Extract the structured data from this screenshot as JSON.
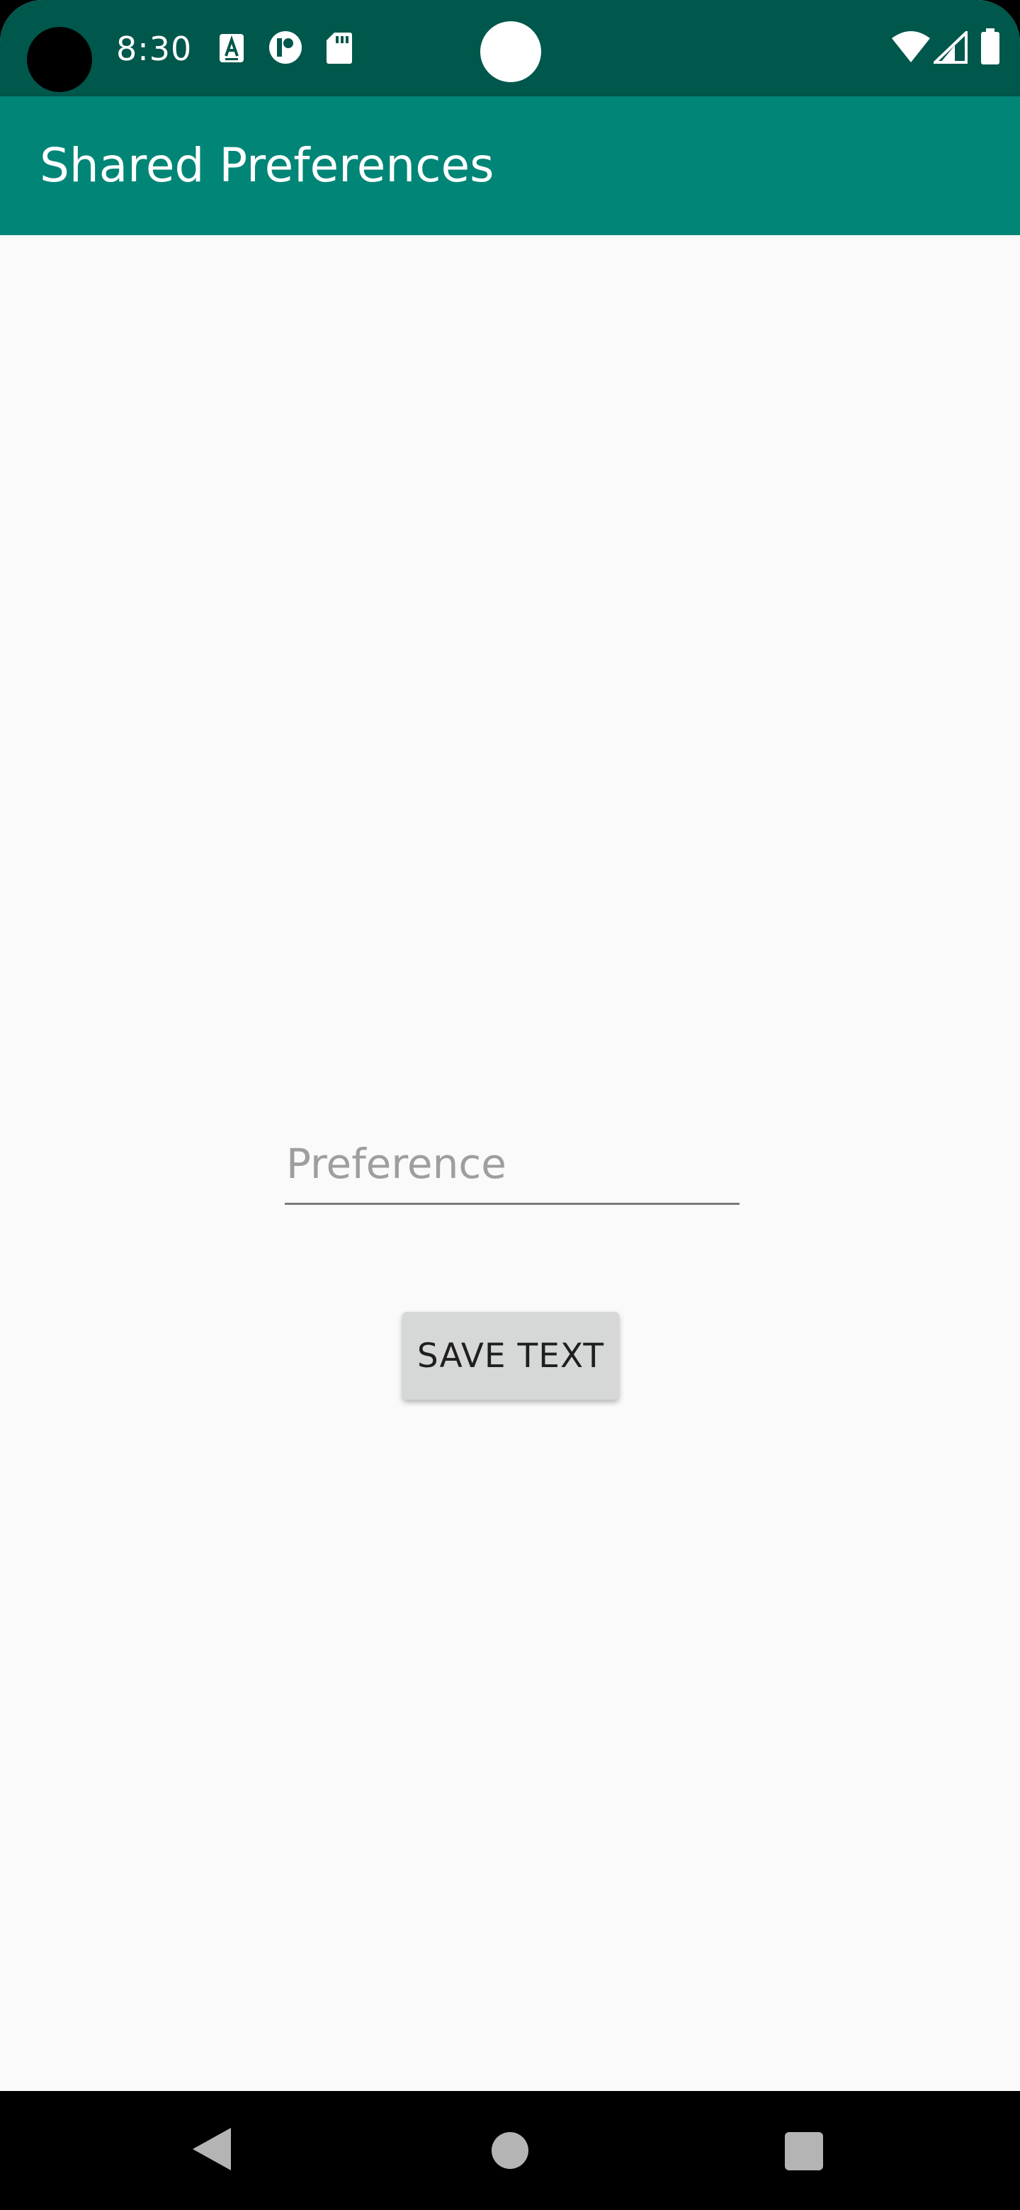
{
  "status_bar": {
    "time": "8:30",
    "left_icons": [
      "a-notification-icon",
      "p-notification-icon",
      "sd-card-icon"
    ],
    "right_icons": [
      "wifi-icon",
      "cell-signal-icon",
      "battery-icon"
    ]
  },
  "app_bar": {
    "title": "Shared Preferences"
  },
  "main": {
    "preference_input": {
      "placeholder": "Preference",
      "value": ""
    },
    "save_button_label": "SAVE TEXT"
  },
  "nav_bar": {
    "buttons": [
      "back-icon",
      "home-icon",
      "recents-icon"
    ]
  },
  "colors": {
    "status_bar": "#00574b",
    "app_bar": "#008577",
    "background": "#fafafa",
    "button": "#d6d7d7"
  }
}
